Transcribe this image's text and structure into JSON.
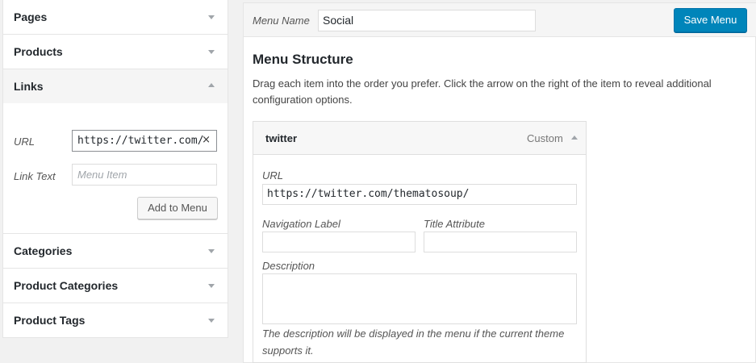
{
  "sidebar": {
    "pages": {
      "label": "Pages"
    },
    "products": {
      "label": "Products"
    },
    "links": {
      "label": "Links",
      "url_label": "URL",
      "url_value": "https://twitter.com/",
      "clear_icon": "×",
      "link_text_label": "Link Text",
      "link_text_placeholder": "Menu Item",
      "add_button": "Add to Menu"
    },
    "categories": {
      "label": "Categories"
    },
    "product_categories": {
      "label": "Product Categories"
    },
    "product_tags": {
      "label": "Product Tags"
    }
  },
  "header": {
    "menu_name_label": "Menu Name",
    "menu_name_value": "Social",
    "save_button": "Save Menu"
  },
  "structure": {
    "title": "Menu Structure",
    "description": "Drag each item into the order you prefer. Click the arrow on the right of the item to reveal additional configuration options.",
    "item": {
      "title": "twitter",
      "type": "Custom",
      "url_label": "URL",
      "url_value": "https://twitter.com/thematosoup/",
      "nav_label": "Navigation Label",
      "nav_value": "",
      "title_attr_label": "Title Attribute",
      "title_attr_value": "",
      "description_label": "Description",
      "help_text": "The description will be displayed in the menu if the current theme supports it."
    }
  },
  "icons": {
    "collapsed": "chevron-down-icon",
    "expanded": "chevron-up-icon"
  },
  "colors": {
    "primary_button": "#0085ba",
    "background": "#f1f1f1"
  }
}
